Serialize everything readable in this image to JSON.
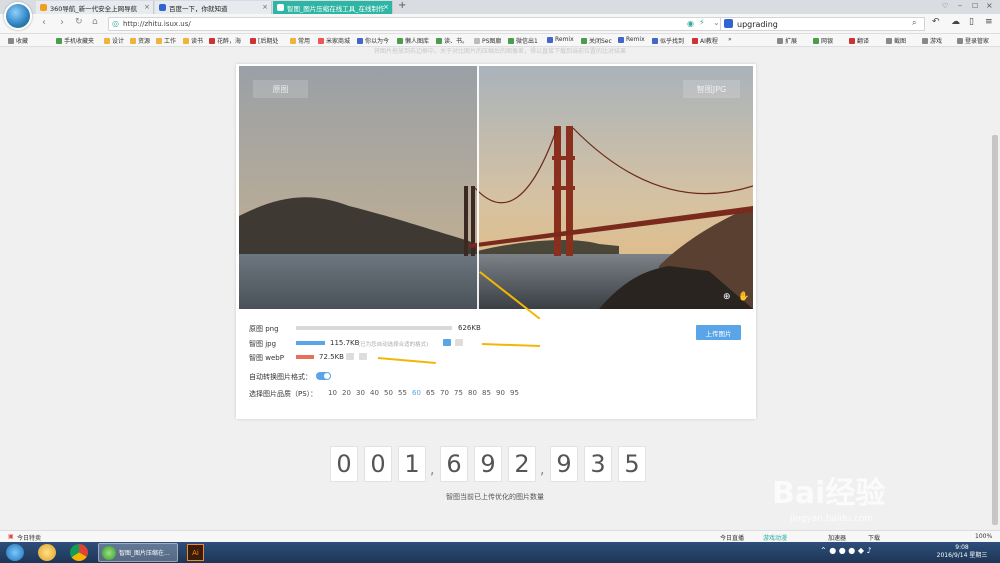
{
  "browser": {
    "tabs": [
      {
        "label": "360导航_新一代安全上网导航"
      },
      {
        "label": "百度一下，你就知道"
      },
      {
        "label": "智图_图片压缩在线工具_在线制作"
      }
    ],
    "new_tab": "+",
    "url": "http://zhitu.isux.us/",
    "search_value": "upgrading",
    "bookmarks": [
      "收藏",
      "手机收藏夹",
      "设计",
      "资源",
      "工作",
      "读书",
      "花醉，海",
      "[后期处",
      "常用",
      "米家商城",
      "你以为今",
      "懒人图库",
      "读、书。",
      "PS图廊",
      "微信出1",
      "Remix",
      "关闭Sec",
      "Remix",
      "似乎找到",
      "AI教程",
      "扩展",
      "网银",
      "翻译",
      "截图",
      "游戏",
      "登录管家"
    ]
  },
  "page": {
    "faded_top_text": "将图片拖放到右边框中，关于对比图片的压缩后的图像差，得以直接下载到当前位置的比对结果",
    "compare": {
      "left_label": "原图",
      "right_label": "智图JPG"
    },
    "rows": [
      {
        "name": "原图 png",
        "size": "626KB",
        "note": "",
        "fraction": 1.0,
        "color": "#d9d9d9"
      },
      {
        "name": "智图 jpg",
        "size": "115.7KB",
        "note": "(已为您自动选择合适的格式)",
        "fraction": 0.185,
        "color": "#5aa4e8"
      },
      {
        "name": "智图 webP",
        "size": "72.5KB",
        "note": "",
        "fraction": 0.116,
        "color": "#e8705a"
      }
    ],
    "upload_label": "上传图片",
    "auto_convert_label": "自动转换图片格式：",
    "quality_label": "选择图片品质（PS）：",
    "quality_options": [
      "10",
      "20",
      "30",
      "40",
      "50",
      "55",
      "60",
      "65",
      "70",
      "75",
      "80",
      "85",
      "90",
      "95"
    ],
    "quality_selected": "60",
    "counter_digits": [
      "0",
      "0",
      "1",
      "6",
      "9",
      "2",
      "9",
      "3",
      "5"
    ],
    "counter_sep": ",",
    "counter_label": "智图当前已上传优化的图片数量"
  },
  "watermark": {
    "text": "Bai经验",
    "url": "jingyan.baidu.com"
  },
  "statusbar": {
    "left": "今日特卖",
    "items": [
      "今日直播",
      "游戏动漫",
      "加速器",
      "下载"
    ],
    "zoom": "100%"
  },
  "taskbar": {
    "window_label": "智图_图片压缩在...",
    "time": "9:08",
    "date": "2016/9/14 星期三"
  },
  "colors": {
    "accent": "#5aa4e8",
    "tab_active": "#2fb5a3",
    "arrow": "#f2b705"
  }
}
